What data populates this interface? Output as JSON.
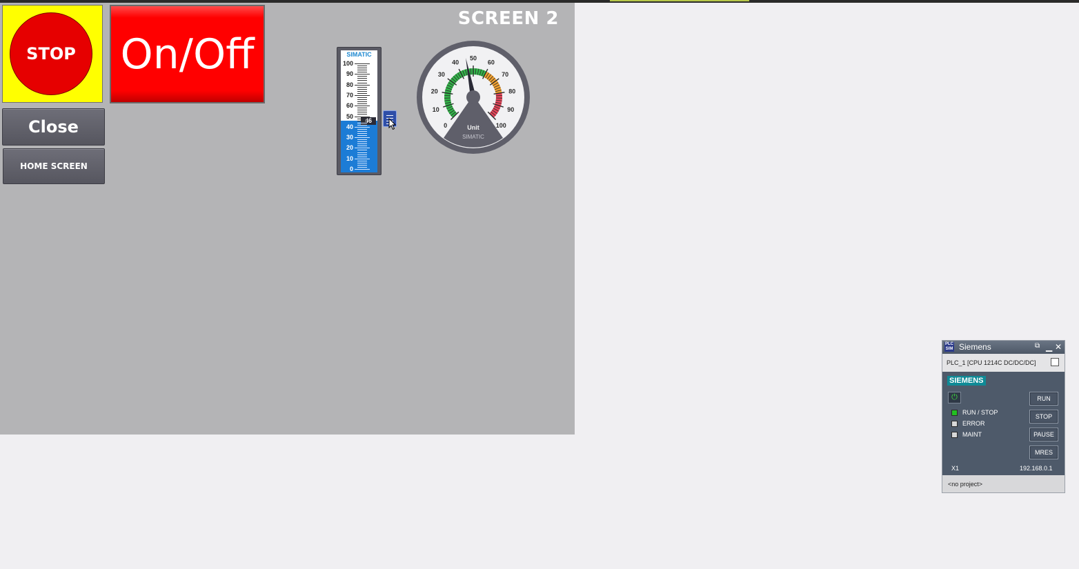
{
  "hmi": {
    "screen_title": "SCREEN 2",
    "stop_label": "STOP",
    "onoff_label": "On/Off",
    "close_label": "Close",
    "home_label": "HOME SCREEN",
    "colors": {
      "stop_background": "#ffff00",
      "stop_circle": "#e60000",
      "onoff": "#ff0000",
      "bar_fill": "#1c7cd6"
    }
  },
  "bar_gauge": {
    "brand": "SIMATIC",
    "value": 46,
    "value_text": "46",
    "min": 0,
    "max": 100,
    "scale_labels": [
      "100",
      "90",
      "80",
      "70",
      "60",
      "50",
      "40",
      "30",
      "20",
      "10",
      "0"
    ]
  },
  "slider": {
    "icon": "slider-thumb-icon"
  },
  "dial_gauge": {
    "value": 46,
    "min": 0,
    "max": 100,
    "unit": "Unit",
    "brand": "SIMATIC",
    "scale_labels": [
      "0",
      "10",
      "20",
      "30",
      "40",
      "50",
      "60",
      "70",
      "80",
      "90",
      "100"
    ],
    "zones": [
      {
        "from": 0,
        "to": 60,
        "color": "#33b54a"
      },
      {
        "from": 60,
        "to": 80,
        "color": "#f0a030"
      },
      {
        "from": 80,
        "to": 100,
        "color": "#e6455a"
      }
    ]
  },
  "plcsim": {
    "title": "Siemens",
    "logo_text_1": "PLC",
    "logo_text_2": "SIM",
    "cpu": "PLC_1 [CPU 1214C DC/DC/DC]",
    "brand": "SIEMENS",
    "leds": [
      {
        "label": "RUN / STOP",
        "color": "#22c022"
      },
      {
        "label": "ERROR",
        "color": "#d8d8d8"
      },
      {
        "label": "MAINT",
        "color": "#d8d8d8"
      }
    ],
    "buttons": [
      "RUN",
      "STOP",
      "PAUSE",
      "MRES"
    ],
    "interface": "X1",
    "ip": "192.168.0.1",
    "project": "<no project>"
  }
}
